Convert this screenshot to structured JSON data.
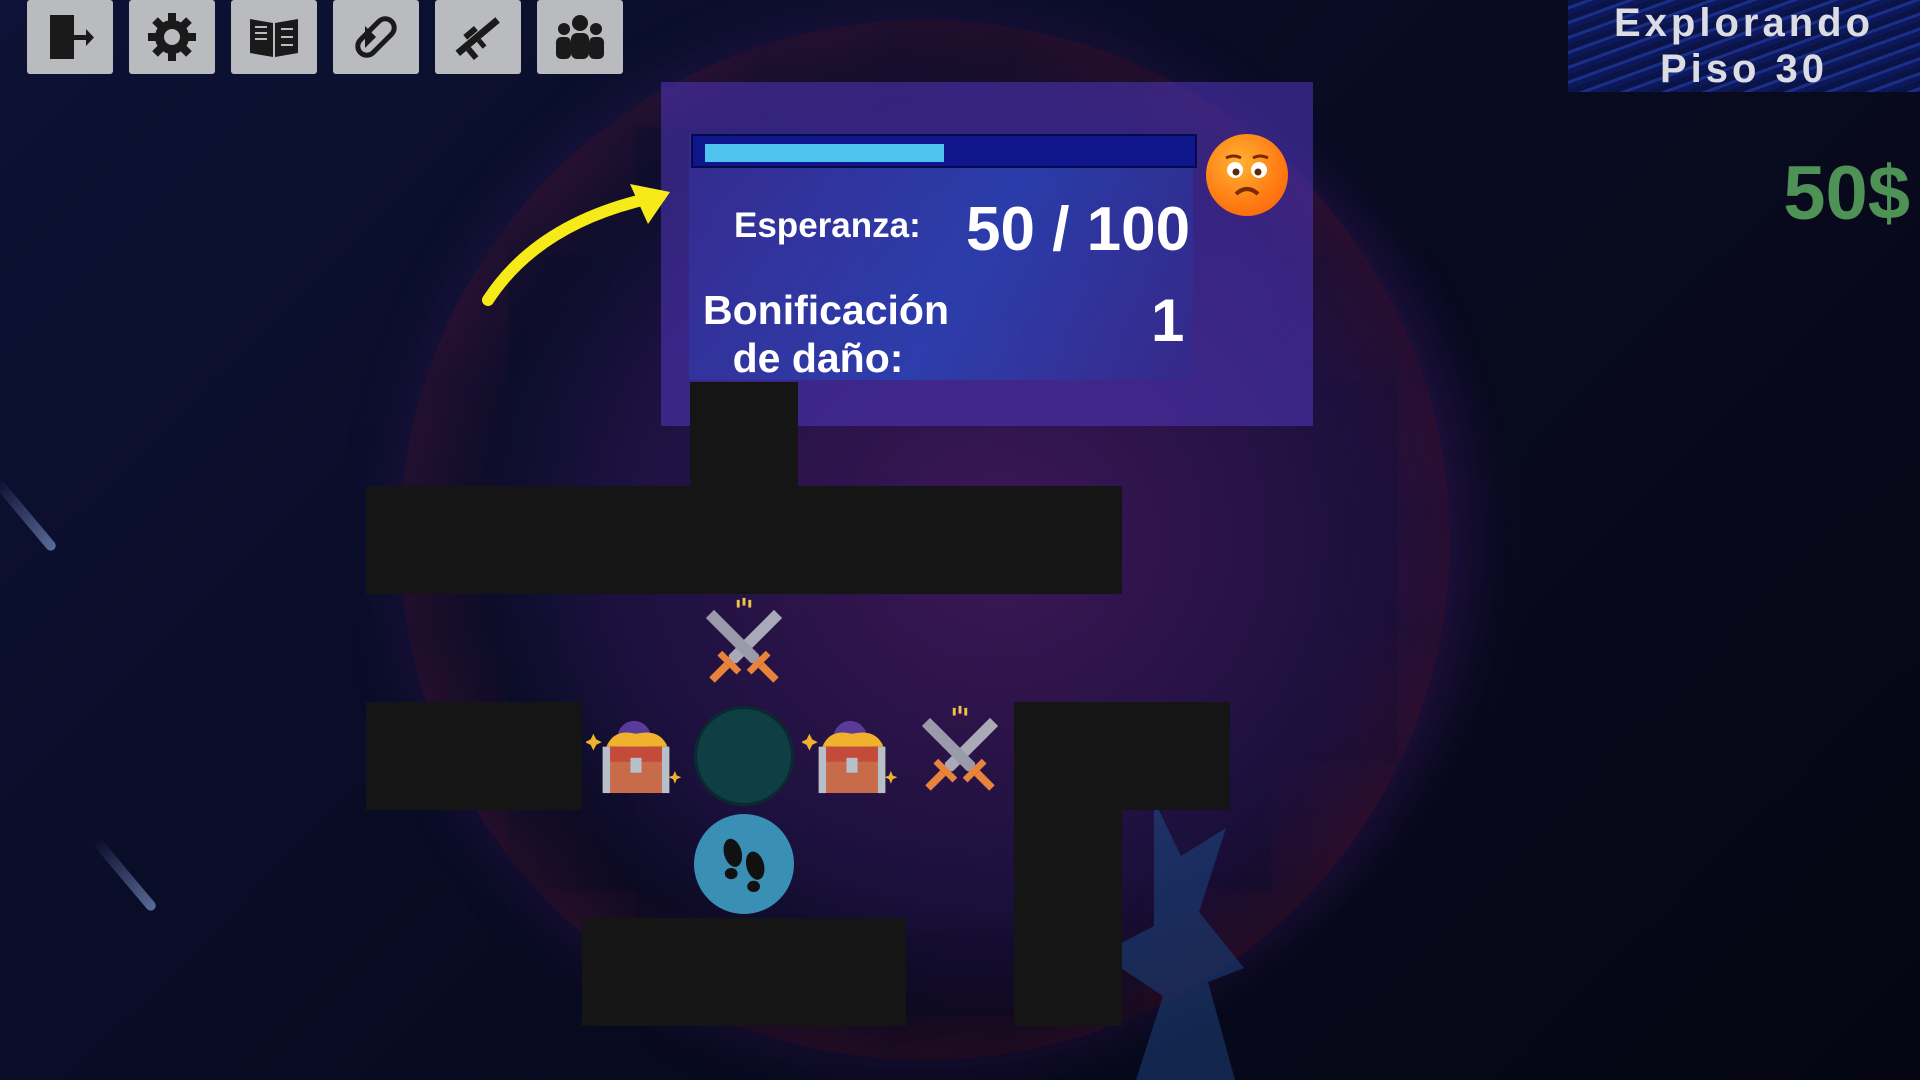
{
  "toolbar": {
    "buttons": [
      {
        "icon": "exit-door-icon"
      },
      {
        "icon": "gear-icon"
      },
      {
        "icon": "journal-book-icon"
      },
      {
        "icon": "pill-capsule-icon"
      },
      {
        "icon": "rifle-icon"
      },
      {
        "icon": "group-people-icon"
      }
    ]
  },
  "status": {
    "line1": "Explorando",
    "line2": "Piso 30"
  },
  "money": "50$",
  "hope_panel": {
    "hope_label": "Esperanza:",
    "hope_value": "50 / 100",
    "hope_fraction": 0.5,
    "bonus_label": "Bonificación de daño:",
    "bonus_value": "1",
    "mood_icon": "sad-face-icon"
  },
  "map": {
    "rooms": [
      {
        "type": "battle",
        "icon": "crossed-swords-icon"
      },
      {
        "type": "treasure",
        "icon": "treasure-chest-icon"
      },
      {
        "type": "current",
        "icon": "current-position-icon"
      },
      {
        "type": "treasure",
        "icon": "treasure-chest-icon"
      },
      {
        "type": "battle",
        "icon": "crossed-swords-icon"
      },
      {
        "type": "visited",
        "icon": "footprints-icon"
      }
    ]
  },
  "colors": {
    "panel": "#5037be",
    "bar_fill": "#4fc3ee",
    "money": "#4e9255",
    "arrow": "#f6ea19"
  }
}
